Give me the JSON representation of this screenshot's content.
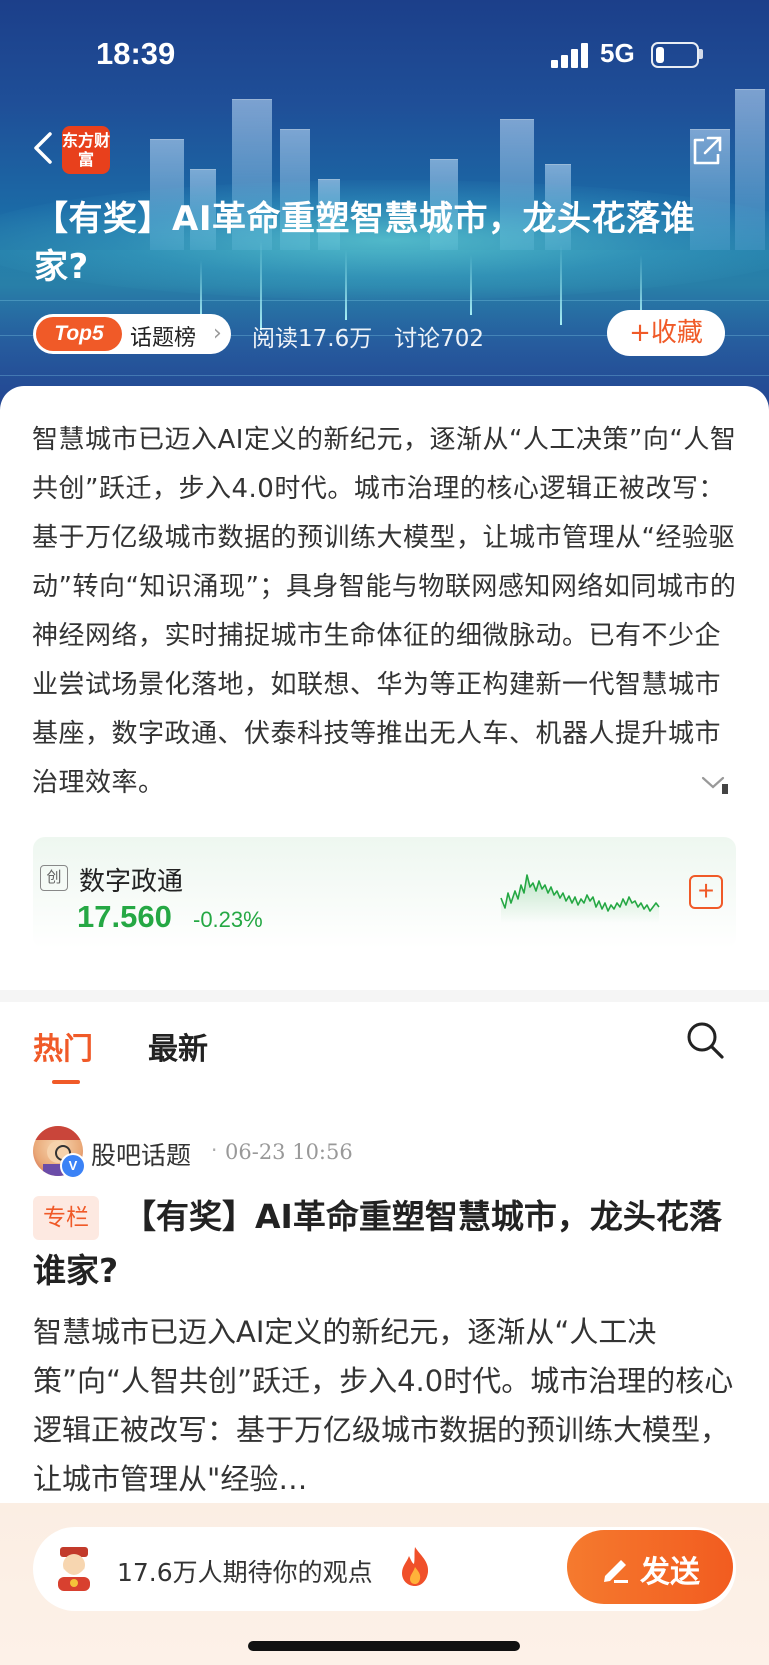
{
  "status_bar": {
    "time": "18:39",
    "network": "5G"
  },
  "header": {
    "logo_text": "东方财富",
    "title": "【有奖】AI革命重塑智慧城市，龙头花落谁家?",
    "top_badge": "Top5",
    "top_label": "话题榜",
    "read_count": "阅读17.6万",
    "discuss_count": "讨论702",
    "favorite_label": "收藏"
  },
  "description": "智慧城市已迈入AI定义的新纪元，逐渐从“人工决策”向“人智共创”跃迁，步入4.0时代。城市治理的核心逻辑正被改写：基于万亿级城市数据的预训练大模型，让城市管理从“经验驱动”转向“知识涌现”；具身智能与物联网感知网络如同城市的神经网络，实时捕捉城市生命体征的细微脉动。已有不少企业尝试场景化落地，如联想、华为等正构建新一代智慧城市基座，数字政通、伏泰科技等推出无人车、机器人提升城市治理效率。",
  "stock": {
    "board_tag": "创",
    "name": "数字政通",
    "price": "17.560",
    "change": "-0.23%",
    "color": "#25a844"
  },
  "tabs": {
    "hot": "热门",
    "latest": "最新"
  },
  "post": {
    "author": "股吧话题",
    "time": "06-23 10:56",
    "column_badge": "专栏",
    "title": "【有奖】AI革命重塑智慧城市，龙头花落谁家?",
    "body": "智慧城市已迈入AI定义的新纪元，逐渐从“人工决策”向“人智共创”跃迁，步入4.0时代。城市治理的核心逻辑正被改写：基于万亿级城市数据的预训练大模型，让城市管理从\"经验…"
  },
  "composer": {
    "placeholder": "17.6万人期待你的观点",
    "send_label": "发送"
  },
  "accent_color": "#f05a28"
}
